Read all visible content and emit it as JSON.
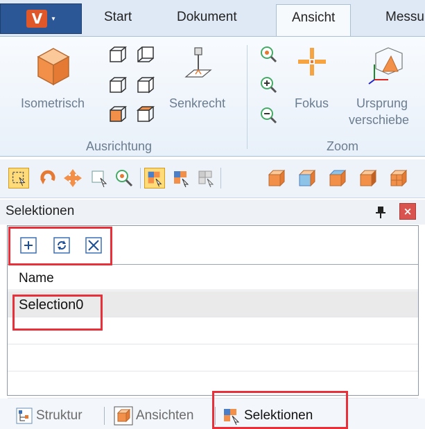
{
  "ribbon": {
    "app_button": {
      "logo_letter": "V",
      "caret": "▾"
    },
    "tabs": [
      {
        "label": "Start",
        "active": false
      },
      {
        "label": "Dokument",
        "active": false
      },
      {
        "label": "Ansicht",
        "active": true
      },
      {
        "label": "Messu",
        "active": false
      }
    ],
    "groups": {
      "ausrichtung": {
        "label": "Ausrichtung",
        "buttons": {
          "isometric": "Isometrisch",
          "perpendicular": "Senkrecht"
        },
        "view_buttons": [
          "front-view",
          "back-view",
          "left-view",
          "right-view",
          "top-view",
          "bottom-view"
        ]
      },
      "zoom": {
        "label": "Zoom",
        "buttons": {
          "focus": "Fokus",
          "origin_line1": "Ursprung",
          "origin_line2": "verschiebe"
        },
        "small_buttons": [
          "zoom-fit",
          "zoom-in",
          "zoom-out"
        ]
      }
    }
  },
  "toolbar": {
    "tools": [
      "select-area-icon",
      "rotate-icon",
      "pan-icon",
      "select-icon",
      "zoom-icon",
      "select-parts-icon",
      "select-add-icon",
      "select-remove-icon",
      "cube-front-icon",
      "cube-back-icon",
      "cube-left-icon",
      "cube-right-icon",
      "cube-top-icon"
    ]
  },
  "pane": {
    "title": "Selektionen",
    "pin_symbol": "📌",
    "close_symbol": "×",
    "toolbar_buttons": [
      "add-selection",
      "refresh-selection",
      "delete-selection"
    ],
    "column_header": "Name",
    "rows": [
      {
        "name": "Selection0",
        "selected": true
      },
      {
        "name": "",
        "selected": false
      },
      {
        "name": "",
        "selected": false
      },
      {
        "name": "",
        "selected": false
      }
    ]
  },
  "bottom_tabs": [
    {
      "label": "Struktur",
      "active": false
    },
    {
      "label": "Ansichten",
      "active": false
    },
    {
      "label": "Selektionen",
      "active": true
    }
  ],
  "colors": {
    "highlight": "#e8303a",
    "accent_orange": "#f0a050",
    "app_blue": "#2b5797",
    "ribbon_bg": "#dfe9f5"
  }
}
